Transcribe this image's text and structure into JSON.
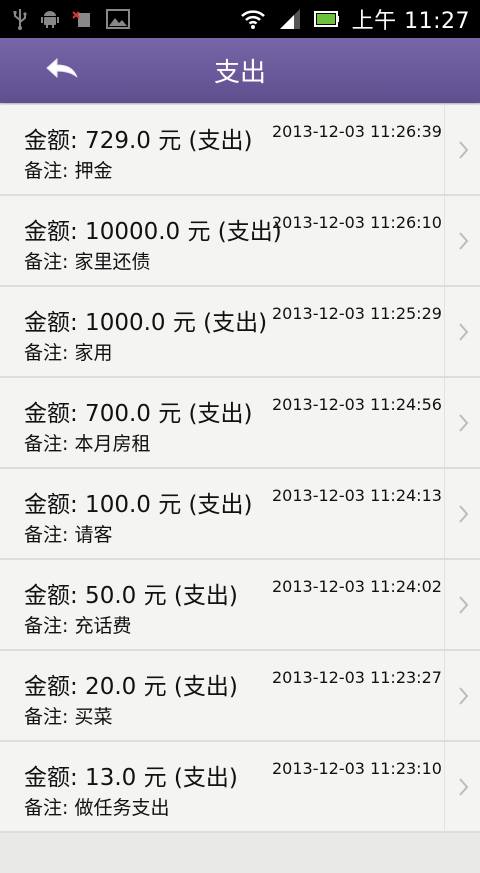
{
  "status_bar": {
    "time": "上午 11:27",
    "icons": [
      "usb-icon",
      "android-debug-icon",
      "sim-error-icon",
      "image-icon",
      "wifi-icon",
      "signal-icon",
      "battery-icon"
    ]
  },
  "header": {
    "title": "支出",
    "back_icon": "back-arrow-icon",
    "color": "#6a5a9a"
  },
  "items": [
    {
      "amount": "金额: 729.0 元 (支出)",
      "note": "备注: 押金",
      "time": "2013-12-03 11:26:39"
    },
    {
      "amount": "金额: 10000.0 元 (支出)",
      "note": "备注: 家里还债",
      "time": "2013-12-03 11:26:10"
    },
    {
      "amount": "金额: 1000.0 元 (支出)",
      "note": "备注: 家用",
      "time": "2013-12-03 11:25:29"
    },
    {
      "amount": "金额: 700.0 元 (支出)",
      "note": "备注: 本月房租",
      "time": "2013-12-03 11:24:56"
    },
    {
      "amount": "金额: 100.0 元 (支出)",
      "note": "备注: 请客",
      "time": "2013-12-03 11:24:13"
    },
    {
      "amount": "金额: 50.0 元 (支出)",
      "note": "备注: 充话费",
      "time": "2013-12-03 11:24:02"
    },
    {
      "amount": "金额: 20.0 元 (支出)",
      "note": "备注: 买菜",
      "time": "2013-12-03 11:23:27"
    },
    {
      "amount": "金额: 13.0 元 (支出)",
      "note": "备注: 做任务支出",
      "time": "2013-12-03 11:23:10"
    }
  ]
}
